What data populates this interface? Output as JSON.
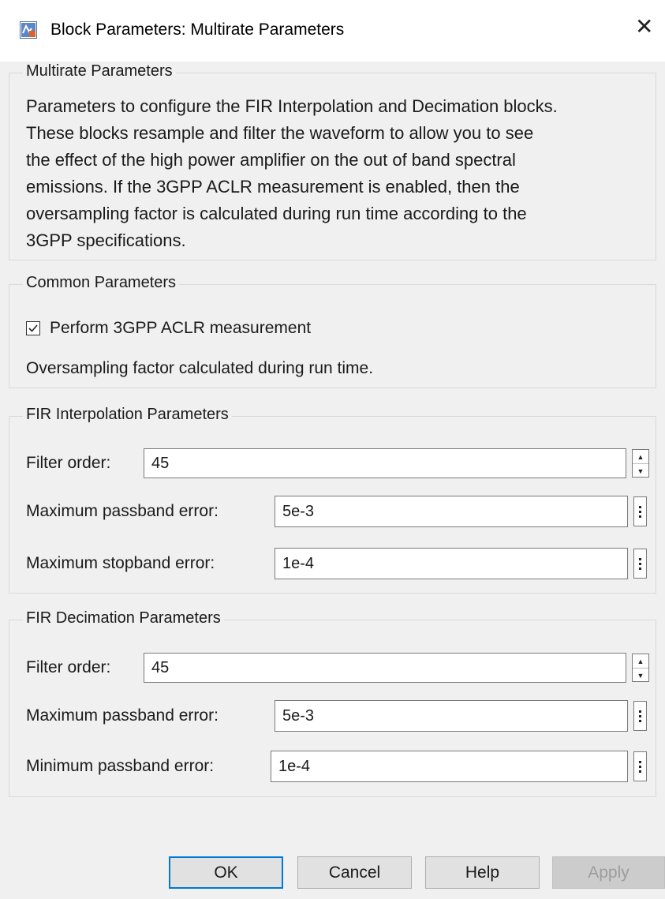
{
  "window": {
    "title": "Block Parameters: Multirate Parameters",
    "close_symbol": "✕"
  },
  "multirate": {
    "legend": "Multirate Parameters",
    "description_lines": [
      "Parameters to configure the FIR Interpolation and Decimation blocks.",
      "These blocks resample and filter the waveform to allow you to see",
      "the effect of the high power amplifier on the out of band spectral",
      "emissions. If the 3GPP ACLR measurement is enabled, then the",
      "oversampling factor is calculated during run time according to the",
      "3GPP specifications."
    ]
  },
  "common": {
    "legend": "Common Parameters",
    "aclr_checkbox_label": "Perform 3GPP ACLR measurement",
    "aclr_checked": true,
    "oversampling_note": "Oversampling factor calculated during run time."
  },
  "interpolation": {
    "legend": "FIR Interpolation Parameters",
    "filter_order_label": "Filter order:",
    "filter_order_value": "45",
    "max_passband_label": "Maximum passband error:",
    "max_passband_value": "5e-3",
    "max_stopband_label": "Maximum stopband error:",
    "max_stopband_value": "1e-4"
  },
  "decimation": {
    "legend": "FIR Decimation Parameters",
    "filter_order_label": "Filter order:",
    "filter_order_value": "45",
    "max_passband_label": "Maximum passband error:",
    "max_passband_value": "5e-3",
    "min_passband_label": "Minimum passband error:",
    "min_passband_value": "1e-4"
  },
  "buttons": {
    "ok": "OK",
    "cancel": "Cancel",
    "help": "Help",
    "apply": "Apply"
  },
  "colors": {
    "accent": "#0078d7",
    "background": "#f0f0f0",
    "disabled_text": "#9d9d9d"
  },
  "icons": {
    "app": "simulink-block-icon",
    "close": "close-icon",
    "check": "checkmark-icon"
  }
}
